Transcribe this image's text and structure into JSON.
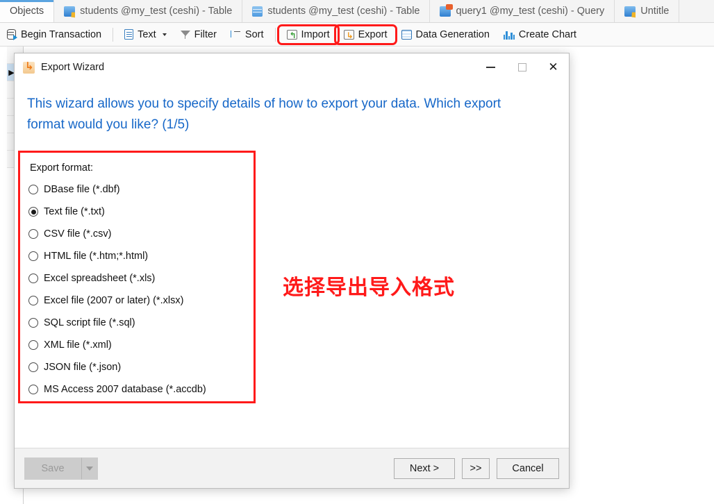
{
  "tabs": [
    {
      "label": "Objects",
      "icon": "none",
      "active": true
    },
    {
      "label": "students @my_test (ceshi) - Table",
      "icon": "table-pen-icon",
      "active": false
    },
    {
      "label": "students @my_test (ceshi) - Table",
      "icon": "table-icon",
      "active": false
    },
    {
      "label": "query1 @my_test (ceshi) - Query",
      "icon": "query-icon",
      "active": false
    },
    {
      "label": "Untitle",
      "icon": "table-pen-icon",
      "active": false
    }
  ],
  "toolbar": {
    "begin_transaction": "Begin Transaction",
    "text": "Text",
    "filter": "Filter",
    "sort": "Sort",
    "import": "Import",
    "export": "Export",
    "data_generation": "Data Generation",
    "create_chart": "Create Chart"
  },
  "annotations": {
    "import_cjk": "导入",
    "export_cjk": "导入",
    "format_cjk": "选择导出导入格式",
    "color": "#ff1a1a"
  },
  "dialog": {
    "title": "Export Wizard",
    "icon": "export-wizard-icon",
    "minimize": "minimize-icon",
    "maximize": "maximize-icon",
    "close": "close-icon",
    "instruction": "This wizard allows you to specify details of how to export your data. Which export format would you like? (1/5)",
    "instruction_color": "#1667c8",
    "format_label": "Export format:",
    "options": [
      {
        "label": "DBase file (*.dbf)",
        "checked": false
      },
      {
        "label": "Text file (*.txt)",
        "checked": true
      },
      {
        "label": "CSV file (*.csv)",
        "checked": false
      },
      {
        "label": "HTML file (*.htm;*.html)",
        "checked": false
      },
      {
        "label": "Excel spreadsheet (*.xls)",
        "checked": false
      },
      {
        "label": "Excel file (2007 or later) (*.xlsx)",
        "checked": false
      },
      {
        "label": "SQL script file (*.sql)",
        "checked": false
      },
      {
        "label": "XML file (*.xml)",
        "checked": false
      },
      {
        "label": "JSON file (*.json)",
        "checked": false
      },
      {
        "label": "MS Access 2007 database (*.accdb)",
        "checked": false
      }
    ],
    "footer": {
      "save": "Save",
      "save_enabled": false,
      "next": "Next >",
      "fast_forward": ">>",
      "cancel": "Cancel"
    }
  }
}
